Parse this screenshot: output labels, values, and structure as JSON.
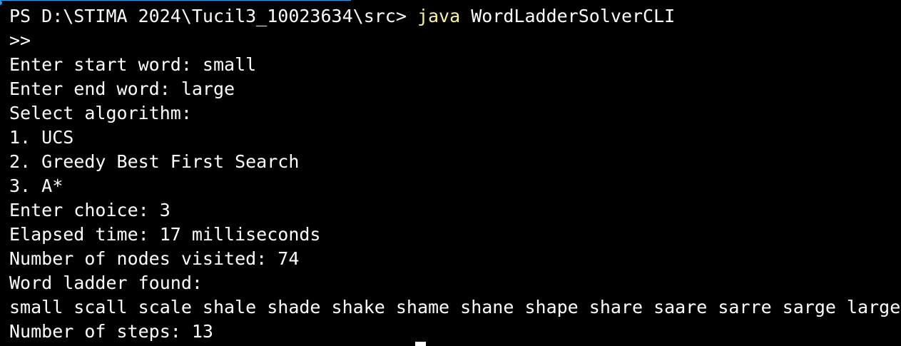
{
  "terminal": {
    "prompt": "PS D:\\STIMA 2024\\Tucil3_10023634\\src> ",
    "command_name": "java",
    "command_args": " WordLadderSolverCLI",
    "lines": [
      ">>",
      "Enter start word: small",
      "Enter end word: large",
      "Select algorithm:",
      "1. UCS",
      "2. Greedy Best First Search",
      "3. A*",
      "Enter choice: 3",
      "Elapsed time: 17 milliseconds",
      "Number of nodes visited: 74",
      "Word ladder found:",
      "small scall scale shale shade shake shame shane shape share saare sarre sarge large",
      "Number of steps: 13"
    ]
  },
  "colors": {
    "background": "#000000",
    "text": "#ffffff",
    "command": "#f9f1a5",
    "accent": "#3a96dd"
  }
}
